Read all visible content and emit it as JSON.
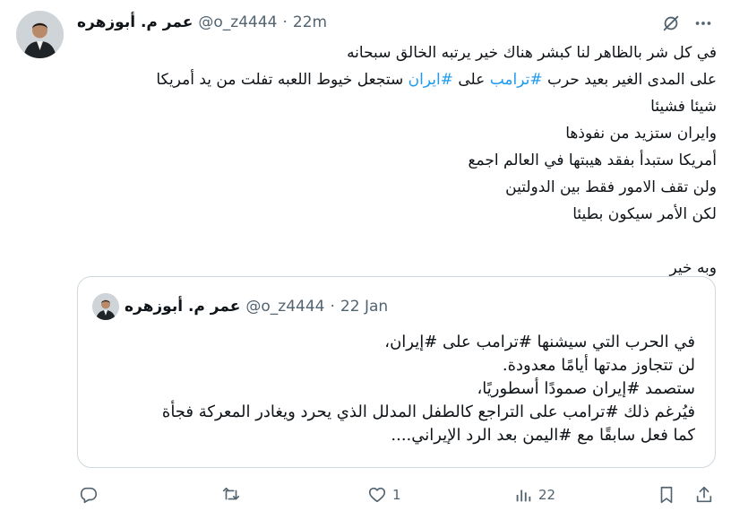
{
  "tweet": {
    "author_name": "عمر م. أبوزهره",
    "handle": "@o_z4444",
    "separator": "·",
    "time": "22m",
    "lines": [
      "في كل شر بالظاهر لنا كبشر هناك خير يرتبه الخالق سبحانه",
      "على المدى الغير بعيد حرب #ترامب على #ايران ستجعل خيوط اللعبه تفلت من يد أمريكا",
      "شيئا فشيئا",
      "وايران ستزيد من نفوذها",
      "أمريكا ستبدأ بفقد هيبتها في العالم اجمع",
      "ولن تقف الامور فقط بين الدولتين",
      "لكن الأمر سيكون بطيئا",
      "وبه خير"
    ],
    "line2_parts": {
      "p1": "على المدى الغير بعيد حرب ",
      "tag1": "#ترامب",
      "p2": " على ",
      "tag2": "#ايران",
      "p3": " ستجعل خيوط اللعبه تفلت من يد أمريكا"
    }
  },
  "quoted_tweet": {
    "author_name": "عمر م. أبوزهره",
    "handle": "@o_z4444",
    "separator": "·",
    "date": "22 Jan",
    "lines": [
      "في الحرب التي سيشنها #ترامب على #إيران،",
      "لن تتجاوز مدتها أيامًا معدودة.",
      "ستصمد #إيران صمودًا أسطوريًا،",
      "فيُرغم ذلك #ترامب على التراجع كالطفل المدلل الذي يحرد ويغادر المعركة فجأة",
      "كما فعل سابقًا مع #اليمن بعد الرد  الإيراني...."
    ]
  },
  "actions": {
    "reply_icon": "reply-icon",
    "retweet_icon": "retweet-icon",
    "like_icon": "heart-icon",
    "like_count": "1",
    "views_icon": "views-icon",
    "views_count": "22",
    "bookmark_icon": "bookmark-icon",
    "share_icon": "share-icon"
  },
  "colors": {
    "text": "#0f1419",
    "secondary": "#536471",
    "link": "#1d9bf0",
    "border": "#cfd9de"
  }
}
